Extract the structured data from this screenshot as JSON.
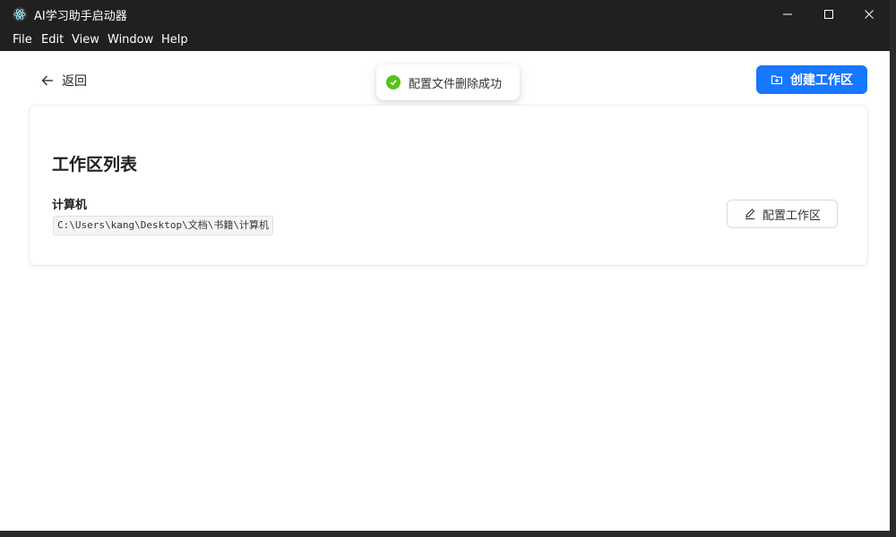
{
  "window": {
    "title": "AI学习助手启动器",
    "app_icon": "electron-icon",
    "controls": [
      "minimize-icon",
      "maximize-icon",
      "close-icon"
    ]
  },
  "menubar": {
    "items": [
      {
        "label": "File"
      },
      {
        "label": "Edit"
      },
      {
        "label": "View"
      },
      {
        "label": "Window"
      },
      {
        "label": "Help"
      }
    ]
  },
  "toolbar": {
    "back_label": "返回",
    "back_icon": "arrow-left-icon",
    "create_label": "创建工作区",
    "create_icon": "folder-add-icon"
  },
  "toast": {
    "message": "配置文件删除成功",
    "icon": "check-circle-icon",
    "color": "#52c41a"
  },
  "workspace_list": {
    "title": "工作区列表",
    "items": [
      {
        "name": "计算机",
        "path": "C:\\Users\\kang\\Desktop\\文档\\书籍\\计算机",
        "config_label": "配置工作区",
        "config_icon": "edit-icon"
      }
    ]
  },
  "colors": {
    "primary": "#1677ff",
    "titlebar": "#202020",
    "success": "#52c41a"
  }
}
